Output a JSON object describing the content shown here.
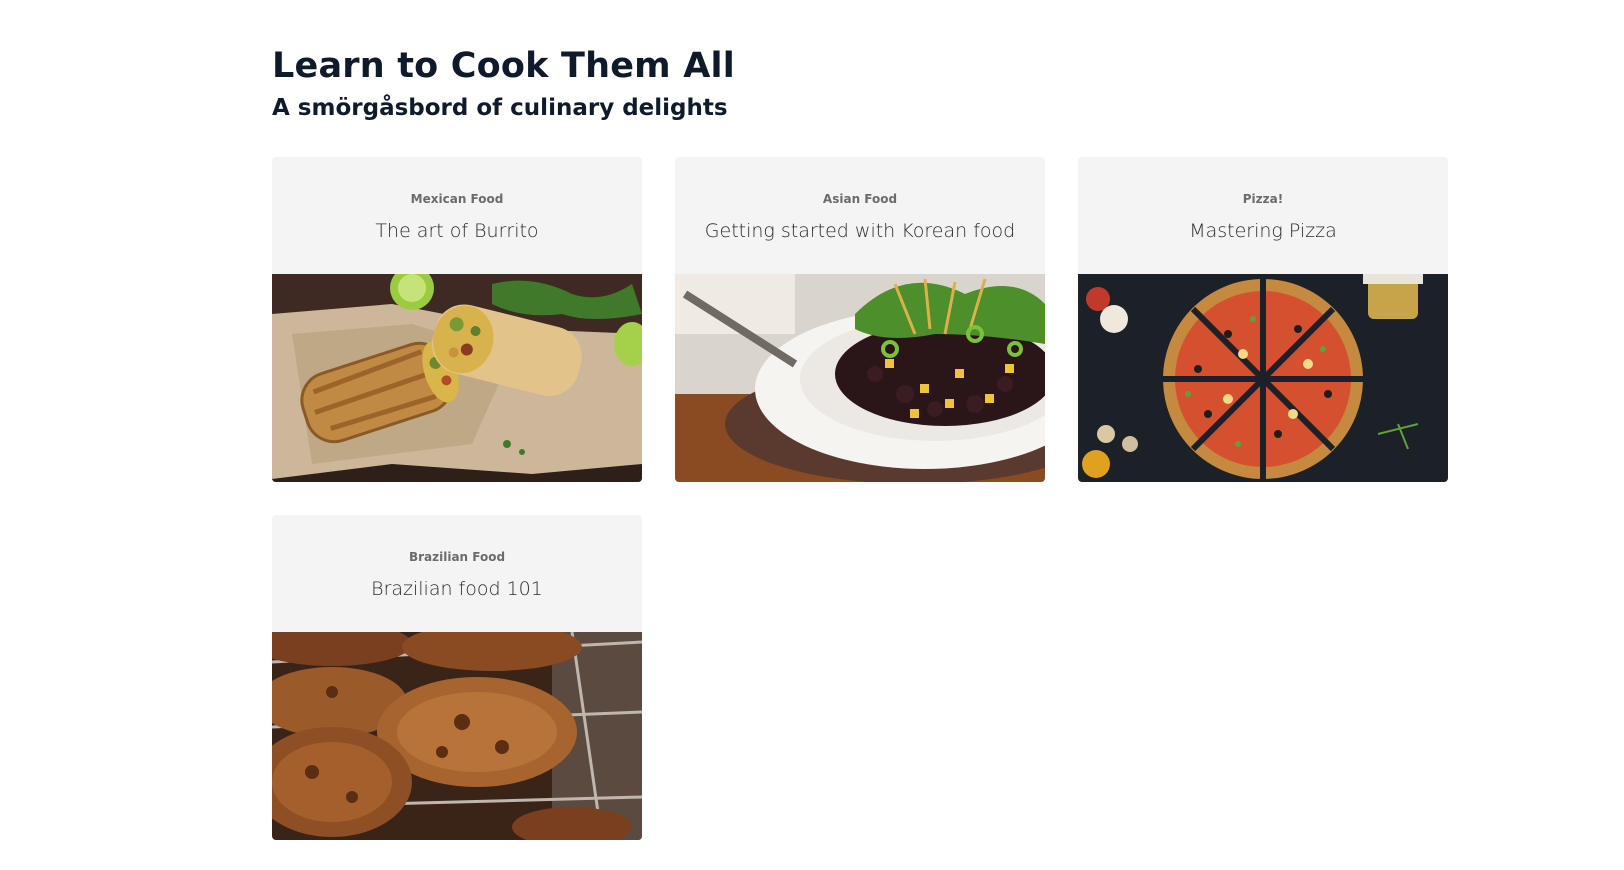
{
  "header": {
    "title": "Learn to Cook Them All",
    "subtitle": "A smörgåsbord of culinary delights"
  },
  "cards": [
    {
      "category": "Mexican Food",
      "title": "The art of Burrito",
      "image": "burrito-photo"
    },
    {
      "category": "Asian Food",
      "title": "Getting started with Korean food",
      "image": "korean-rice-bowl-photo"
    },
    {
      "category": "Pizza!",
      "title": "Mastering Pizza",
      "image": "sliced-pizza-photo"
    },
    {
      "category": "Brazilian Food",
      "title": "Brazilian food 101",
      "image": "grilled-meat-skewers-photo"
    }
  ],
  "colors": {
    "heading": "#0f1b2a",
    "card_background": "#f4f4f4",
    "category_text": "#6b6b6b",
    "card_title_text": "#2b2b2b"
  }
}
